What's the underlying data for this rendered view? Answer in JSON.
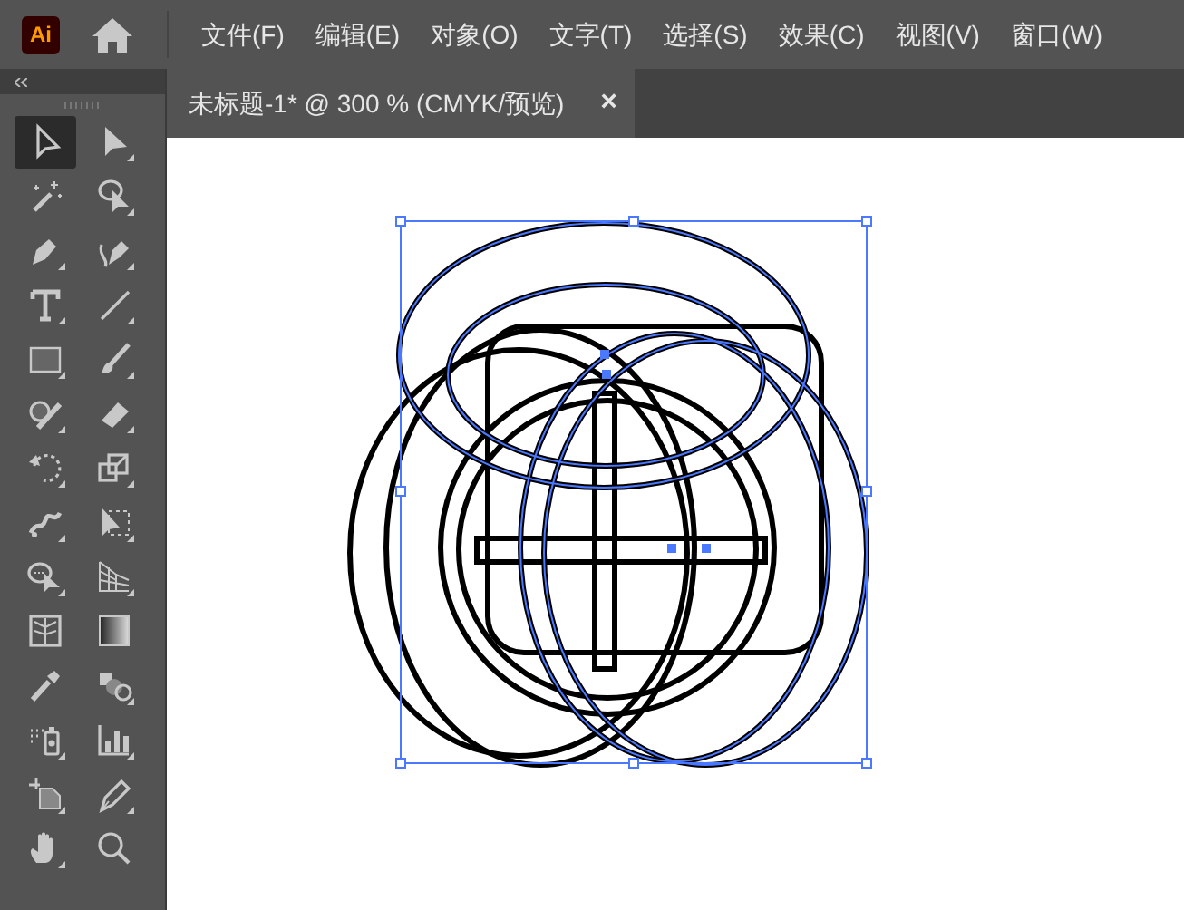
{
  "app": {
    "logo": "Ai"
  },
  "menu": [
    {
      "label": "文件(F)"
    },
    {
      "label": "编辑(E)"
    },
    {
      "label": "对象(O)"
    },
    {
      "label": "文字(T)"
    },
    {
      "label": "选择(S)"
    },
    {
      "label": "效果(C)"
    },
    {
      "label": "视图(V)"
    },
    {
      "label": "窗口(W)"
    }
  ],
  "document_tab": {
    "title": "未标题-1* @ 300 % (CMYK/预览)",
    "close": "×",
    "selected": true
  },
  "tools": [
    {
      "selected": true
    },
    {
      "selected": false
    },
    {
      "selected": false
    },
    {
      "selected": false
    },
    {
      "selected": false
    },
    {
      "selected": false
    },
    {
      "selected": false
    },
    {
      "selected": false
    },
    {
      "selected": false
    },
    {
      "selected": false
    },
    {
      "selected": false
    },
    {
      "selected": false
    },
    {
      "selected": false
    },
    {
      "selected": false
    },
    {
      "selected": false
    },
    {
      "selected": false
    },
    {
      "selected": false
    },
    {
      "selected": false
    },
    {
      "selected": false
    },
    {
      "selected": false
    },
    {
      "selected": false
    },
    {
      "selected": false
    },
    {
      "selected": false
    },
    {
      "selected": false
    },
    {
      "selected": false
    },
    {
      "selected": false
    },
    {
      "selected": false
    },
    {
      "selected": false
    }
  ]
}
